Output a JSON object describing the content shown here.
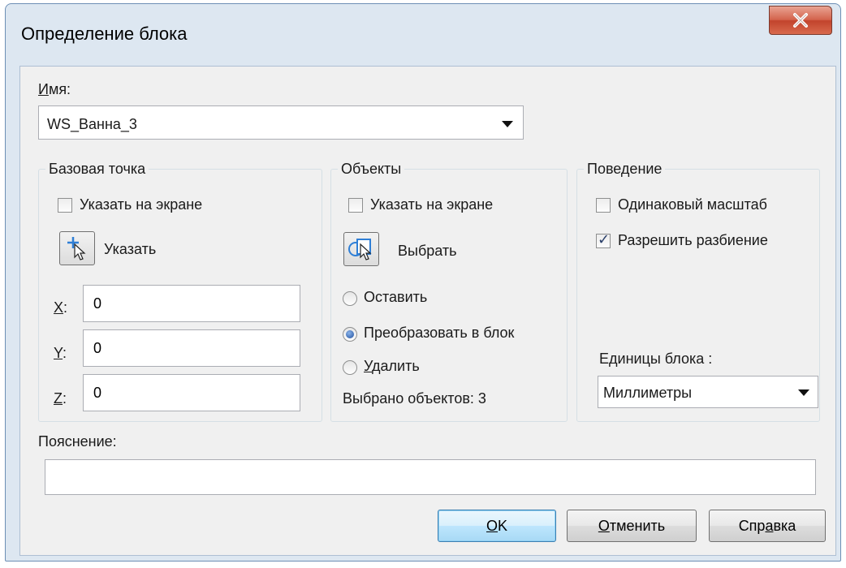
{
  "window": {
    "title": "Определение блока",
    "close_glyph": "X"
  },
  "name": {
    "label_u": "И",
    "label_rest": "мя:",
    "value": "WS_Ванна_3"
  },
  "base_point": {
    "title": "Базовая точка",
    "specify_on_screen": "Указать на экране",
    "specify_on_screen_checked": false,
    "pick_label": "Указать",
    "pick_icon": "pick-point-icon",
    "x_label_u": "X",
    "y_label_u": "Y",
    "z_label_u": "Z",
    "colon": ":",
    "x": "0",
    "y": "0",
    "z": "0"
  },
  "objects": {
    "title": "Объекты",
    "specify_on_screen": "Указать на экране",
    "specify_on_screen_checked": false,
    "select_label": "Выбрать",
    "select_icon": "select-objects-icon",
    "retain": "Оставить",
    "convert": "Преобразовать в блок",
    "delete_u": "У",
    "delete_rest": "далить",
    "selected_mode": "convert",
    "selected_count": "Выбрано объектов: 3"
  },
  "behavior": {
    "title": "Поведение",
    "uniform_scale": "Одинаковый масштаб",
    "uniform_scale_checked": false,
    "allow_explode": "Разрешить разбиение",
    "allow_explode_checked": true,
    "units_label": "Единицы блока :",
    "units_value": "Миллиметры"
  },
  "description": {
    "label": "Пояснение:",
    "value": ""
  },
  "buttons": {
    "ok_u": "O",
    "ok_rest": "K",
    "cancel_u": "О",
    "cancel_rest": "тменить",
    "help_pre": "Спр",
    "help_u": "а",
    "help_rest": "вка"
  },
  "colors": {
    "close_button": "#c2432c",
    "default_button_border": "#3c7fb1",
    "check_mark": "#2a3f6a"
  }
}
